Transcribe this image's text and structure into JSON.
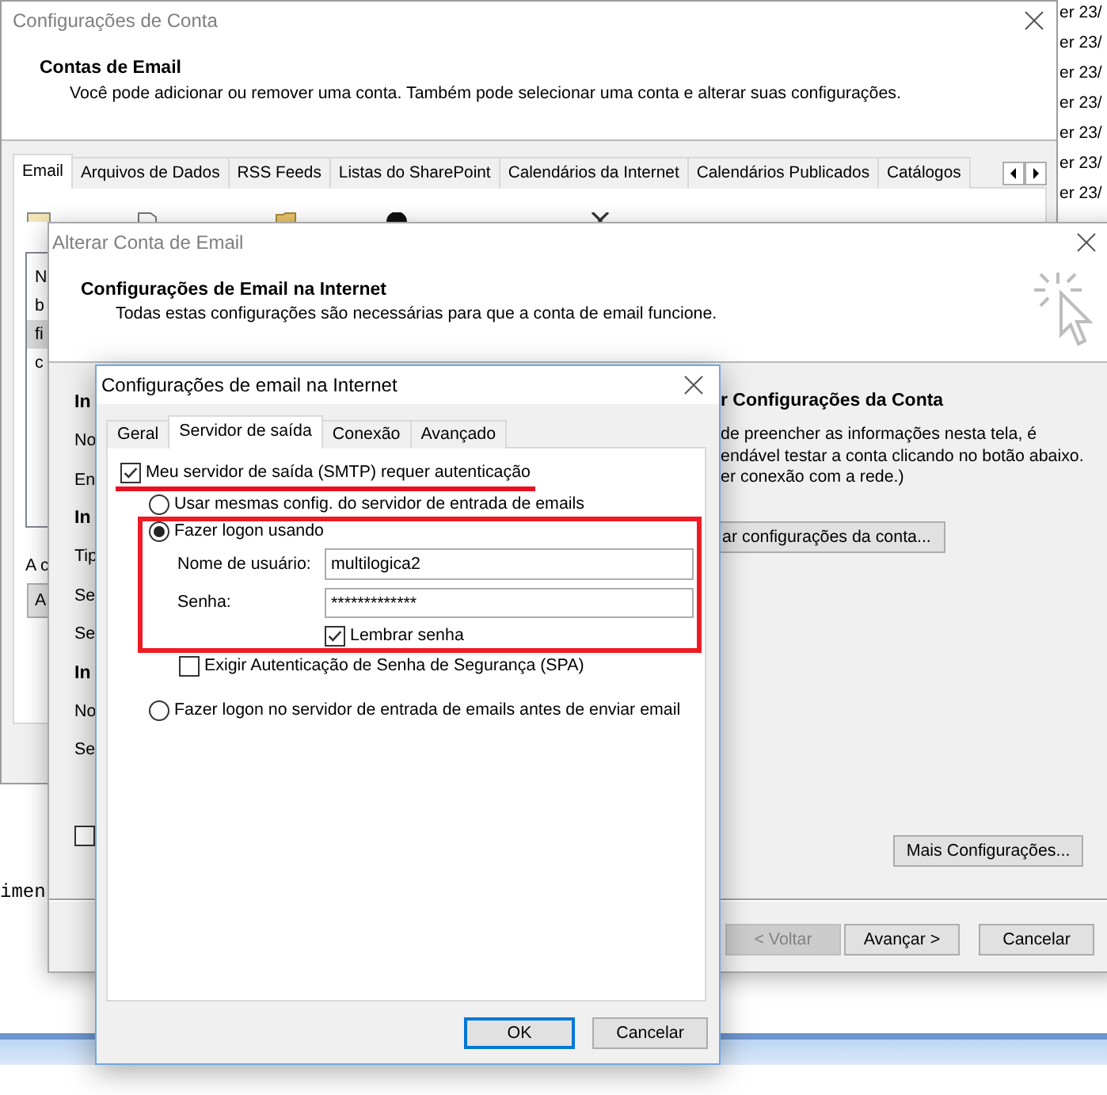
{
  "background": {
    "date_column": [
      "er 23/",
      "er 23/",
      "er 23/",
      "er 23/",
      "er 23/",
      "er 23/",
      "er 23/"
    ],
    "console_text": "imen"
  },
  "account_settings": {
    "title": "Configurações de Conta",
    "heading": "Contas de Email",
    "description": "Você pode adicionar ou remover uma conta. Também pode selecionar uma conta e alterar suas configurações.",
    "tabs": [
      {
        "label": "Email",
        "selected": true
      },
      {
        "label": "Arquivos de Dados",
        "selected": false
      },
      {
        "label": "RSS Feeds",
        "selected": false
      },
      {
        "label": "Listas do SharePoint",
        "selected": false
      },
      {
        "label": "Calendários da Internet",
        "selected": false
      },
      {
        "label": "Calendários Publicados",
        "selected": false
      },
      {
        "label": "Catálogos",
        "selected": false
      }
    ],
    "account_list": [
      {
        "text": "N",
        "selected": false
      },
      {
        "text": "b",
        "selected": false
      },
      {
        "text": "fi",
        "selected": true
      },
      {
        "text": "c",
        "selected": false
      }
    ],
    "label_fragment": "A c",
    "button_fragment": "A"
  },
  "change_account": {
    "title": "Alterar Conta de Email",
    "heading": "Configurações de Email na Internet",
    "description": "Todas estas configurações são necessárias para que a conta de email funcione.",
    "form_fragments": [
      {
        "text": "In",
        "kind": "heading"
      },
      {
        "text": "No",
        "kind": "label"
      },
      {
        "text": "En",
        "kind": "label"
      },
      {
        "text": "In",
        "kind": "heading"
      },
      {
        "text": "Tip",
        "kind": "label"
      },
      {
        "text": "Se",
        "kind": "label"
      },
      {
        "text": "Se",
        "kind": "label"
      },
      {
        "text": "In",
        "kind": "heading"
      },
      {
        "text": "No",
        "kind": "label"
      },
      {
        "text": "Se",
        "kind": "label"
      }
    ],
    "option_checkbox": {
      "checked": false
    },
    "test_section": {
      "heading": "r Configurações da Conta",
      "lines": [
        "de preencher as informações nesta tela, é",
        "endável testar a conta clicando no botão abaixo.",
        "er conexão com a rede.)"
      ],
      "button": "ar configurações da conta..."
    },
    "more_settings_button": "Mais Configurações...",
    "buttons": [
      {
        "label": "< Voltar",
        "disabled": true
      },
      {
        "label": "Avançar >",
        "disabled": false
      },
      {
        "label": "Cancelar",
        "disabled": false
      }
    ]
  },
  "internet_settings": {
    "title": "Configurações de email na Internet",
    "tabs": [
      {
        "label": "Geral",
        "selected": false
      },
      {
        "label": "Servidor de saída",
        "selected": true
      },
      {
        "label": "Conexão",
        "selected": false
      },
      {
        "label": "Avançado",
        "selected": false
      }
    ],
    "smtp_auth": {
      "label": "Meu servidor de saída (SMTP) requer autenticação",
      "checked": true,
      "annotated": true
    },
    "auth_items": [
      {
        "kind": "radio",
        "label": "Usar mesmas config. do servidor de entrada de emails",
        "selected": false
      },
      {
        "kind": "radio",
        "label": "Fazer logon usando",
        "selected": true,
        "annotated": true,
        "fields": [
          {
            "label": "Nome de usuário:",
            "value": "multilogica2"
          },
          {
            "label": "Senha:",
            "value": "*************"
          }
        ],
        "remember_password": {
          "label": "Lembrar senha",
          "checked": true
        }
      },
      {
        "kind": "checkbox",
        "label": "Exigir Autenticação de Senha de Segurança (SPA)",
        "checked": false
      },
      {
        "kind": "radio",
        "label": "Fazer logon no servidor de entrada de emails antes de enviar email",
        "selected": false
      }
    ],
    "buttons": [
      {
        "label": "OK",
        "default": true
      },
      {
        "label": "Cancelar",
        "default": false
      }
    ]
  }
}
